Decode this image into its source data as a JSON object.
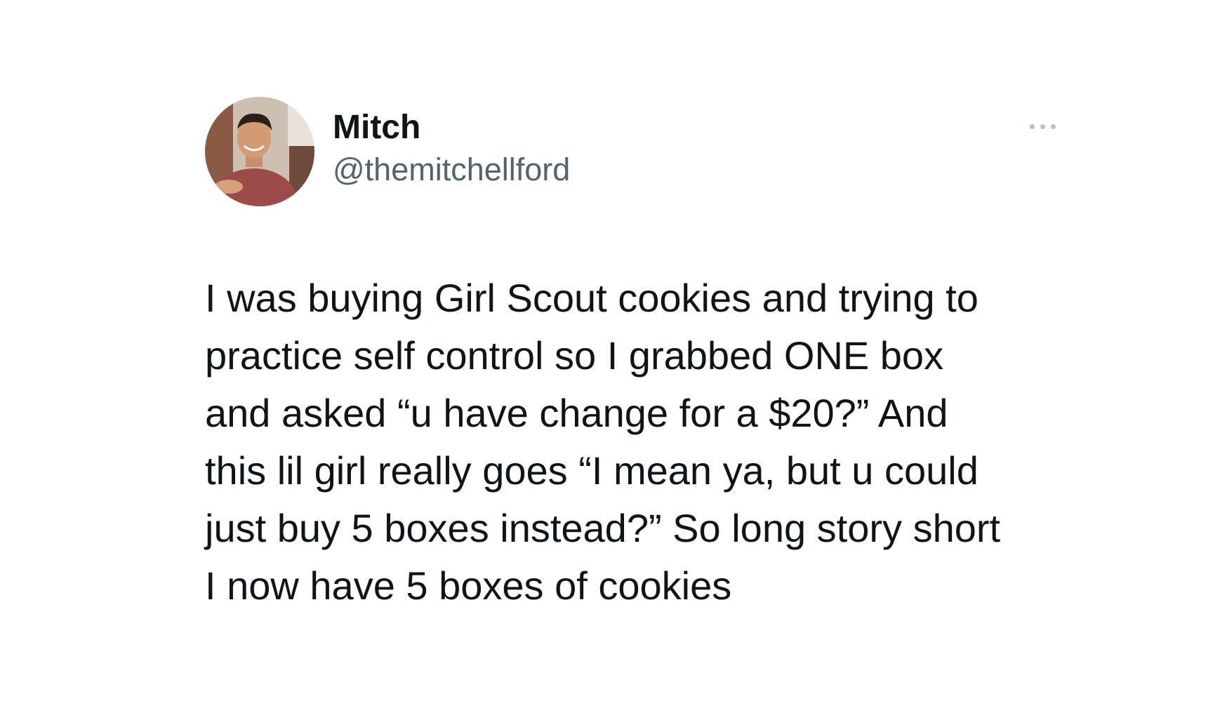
{
  "tweet": {
    "author": {
      "display_name": "Mitch",
      "handle": "@themitchellford"
    },
    "more_icon": "more-horizontal-icon",
    "text_lines": [
      "I was buying Girl Scout cookies and trying to",
      "practice self control so I grabbed ONE box",
      "and asked “u have change for a $20?” And",
      "this lil girl really goes “I mean ya, but u could",
      "just buy 5 boxes instead?” So long story short",
      "I now have 5 boxes of cookies"
    ]
  },
  "colors": {
    "text_primary": "#0f1419",
    "text_secondary": "#536471",
    "background": "#ffffff"
  }
}
